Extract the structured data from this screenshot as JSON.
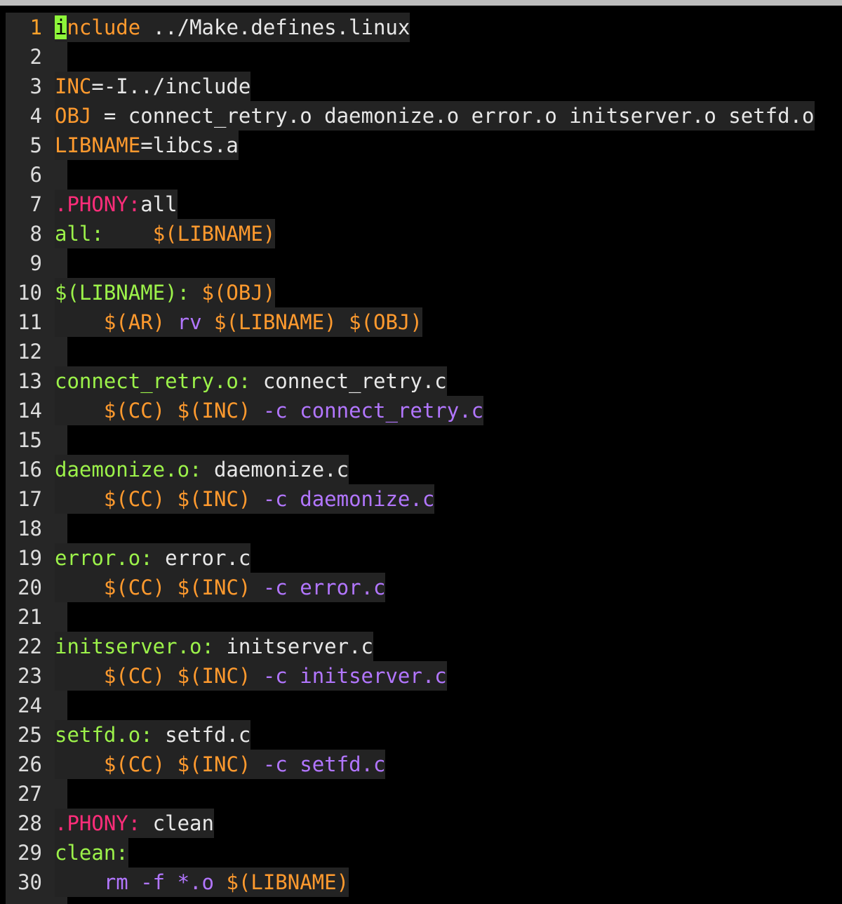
{
  "editor": {
    "current_line": 1,
    "lines": [
      {
        "n": "1",
        "tokens": [
          {
            "t": "i",
            "c": "cursor"
          },
          {
            "t": "nclude",
            "c": "orange"
          },
          {
            "t": " ../Make.defines.linux",
            "c": "white"
          }
        ]
      },
      {
        "n": "2",
        "tokens": []
      },
      {
        "n": "3",
        "tokens": [
          {
            "t": "INC",
            "c": "orange"
          },
          {
            "t": "=-I../include",
            "c": "white"
          }
        ]
      },
      {
        "n": "4",
        "tokens": [
          {
            "t": "OBJ",
            "c": "orange"
          },
          {
            "t": " = connect_retry.o daemonize.o error.o initserver.o setfd.o",
            "c": "white"
          }
        ]
      },
      {
        "n": "5",
        "tokens": [
          {
            "t": "LIBNAME",
            "c": "orange"
          },
          {
            "t": "=libcs.a",
            "c": "white"
          }
        ]
      },
      {
        "n": "6",
        "tokens": []
      },
      {
        "n": "7",
        "tokens": [
          {
            "t": ".PHONY:",
            "c": "pink"
          },
          {
            "t": "all",
            "c": "white"
          }
        ]
      },
      {
        "n": "8",
        "tokens": [
          {
            "t": "all:",
            "c": "green"
          },
          {
            "t": "    ",
            "c": "white"
          },
          {
            "t": "$(LIBNAME)",
            "c": "orange"
          }
        ]
      },
      {
        "n": "9",
        "tokens": []
      },
      {
        "n": "10",
        "tokens": [
          {
            "t": "$(LIBNAME): ",
            "c": "green"
          },
          {
            "t": "$(OBJ)",
            "c": "orange"
          }
        ]
      },
      {
        "n": "11",
        "tokens": [
          {
            "t": "    ",
            "c": "white"
          },
          {
            "t": "$(AR)",
            "c": "orange"
          },
          {
            "t": " rv ",
            "c": "purple"
          },
          {
            "t": "$(LIBNAME)",
            "c": "orange"
          },
          {
            "t": " ",
            "c": "white"
          },
          {
            "t": "$(OBJ)",
            "c": "orange"
          }
        ]
      },
      {
        "n": "12",
        "tokens": []
      },
      {
        "n": "13",
        "tokens": [
          {
            "t": "connect_retry.o:",
            "c": "green"
          },
          {
            "t": " connect_retry.c",
            "c": "white"
          }
        ]
      },
      {
        "n": "14",
        "tokens": [
          {
            "t": "    ",
            "c": "white"
          },
          {
            "t": "$(CC)",
            "c": "orange"
          },
          {
            "t": " ",
            "c": "white"
          },
          {
            "t": "$(INC)",
            "c": "orange"
          },
          {
            "t": " -c connect_retry.c",
            "c": "purple"
          }
        ]
      },
      {
        "n": "15",
        "tokens": []
      },
      {
        "n": "16",
        "tokens": [
          {
            "t": "daemonize.o:",
            "c": "green"
          },
          {
            "t": " daemonize.c",
            "c": "white"
          }
        ]
      },
      {
        "n": "17",
        "tokens": [
          {
            "t": "    ",
            "c": "white"
          },
          {
            "t": "$(CC)",
            "c": "orange"
          },
          {
            "t": " ",
            "c": "white"
          },
          {
            "t": "$(INC)",
            "c": "orange"
          },
          {
            "t": " -c daemonize.c",
            "c": "purple"
          }
        ]
      },
      {
        "n": "18",
        "tokens": []
      },
      {
        "n": "19",
        "tokens": [
          {
            "t": "error.o:",
            "c": "green"
          },
          {
            "t": " error.c",
            "c": "white"
          }
        ]
      },
      {
        "n": "20",
        "tokens": [
          {
            "t": "    ",
            "c": "white"
          },
          {
            "t": "$(CC)",
            "c": "orange"
          },
          {
            "t": " ",
            "c": "white"
          },
          {
            "t": "$(INC)",
            "c": "orange"
          },
          {
            "t": " -c error.c",
            "c": "purple"
          }
        ]
      },
      {
        "n": "21",
        "tokens": []
      },
      {
        "n": "22",
        "tokens": [
          {
            "t": "initserver.o:",
            "c": "green"
          },
          {
            "t": " initserver.c",
            "c": "white"
          }
        ]
      },
      {
        "n": "23",
        "tokens": [
          {
            "t": "    ",
            "c": "white"
          },
          {
            "t": "$(CC)",
            "c": "orange"
          },
          {
            "t": " ",
            "c": "white"
          },
          {
            "t": "$(INC)",
            "c": "orange"
          },
          {
            "t": " -c initserver.c",
            "c": "purple"
          }
        ]
      },
      {
        "n": "24",
        "tokens": []
      },
      {
        "n": "25",
        "tokens": [
          {
            "t": "setfd.o:",
            "c": "green"
          },
          {
            "t": " setfd.c",
            "c": "white"
          }
        ]
      },
      {
        "n": "26",
        "tokens": [
          {
            "t": "    ",
            "c": "white"
          },
          {
            "t": "$(CC)",
            "c": "orange"
          },
          {
            "t": " ",
            "c": "white"
          },
          {
            "t": "$(INC)",
            "c": "orange"
          },
          {
            "t": " -c setfd.c",
            "c": "purple"
          }
        ]
      },
      {
        "n": "27",
        "tokens": []
      },
      {
        "n": "28",
        "tokens": [
          {
            "t": ".PHONY:",
            "c": "pink"
          },
          {
            "t": " clean",
            "c": "white"
          }
        ]
      },
      {
        "n": "29",
        "tokens": [
          {
            "t": "clean:",
            "c": "green"
          }
        ]
      },
      {
        "n": "30",
        "tokens": [
          {
            "t": "    ",
            "c": "white"
          },
          {
            "t": "rm -f *.o ",
            "c": "purple"
          },
          {
            "t": "$(LIBNAME)",
            "c": "orange"
          }
        ]
      }
    ]
  },
  "colors": {
    "background": "#000000",
    "gutter": "#262626",
    "line_bg": "#232323",
    "keyword_orange": "#ff9a2e",
    "target_green": "#9cf24a",
    "phony_pink": "#ff2d7a",
    "command_purple": "#b276ff",
    "text_white": "#e8e8e8",
    "cursor": "#8ef53a"
  }
}
